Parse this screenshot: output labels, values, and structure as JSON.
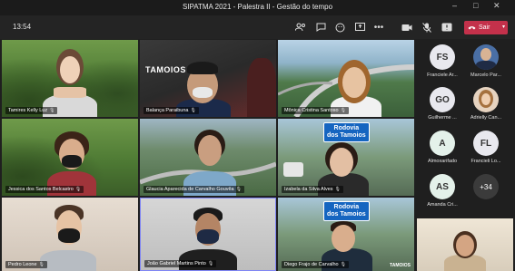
{
  "window": {
    "title": "SIPATMA 2021 - Palestra II - Gestão do tempo"
  },
  "toolbar": {
    "timer": "13:54",
    "leave_label": "Sair"
  },
  "participants": [
    {
      "name": "Tamires Kelly Luz"
    },
    {
      "name": "Balança Paraibuna"
    },
    {
      "name": "Mônica Cristina Santoso"
    },
    {
      "name": "Jessica dos Santos Belcastro"
    },
    {
      "name": "Glaucia Aparecida de Carvalho Gouvêa"
    },
    {
      "name": "Izabela da Silva Alves"
    },
    {
      "name": "Pedro Leone"
    },
    {
      "name": "João Gabriel Martins Pinto"
    },
    {
      "name": "Diego Frajo de Carvalho"
    }
  ],
  "tile_texts": {
    "logo_text": "TAMOIOS",
    "road_sign_line1": "Rodovia",
    "road_sign_line2": "dos Tamoios"
  },
  "side_participants": [
    {
      "initials": "FS",
      "label": "Franciele Ar...",
      "color": "#e8e8ee"
    },
    {
      "initials": "",
      "label": "Marcelo Par...",
      "color": "#4a6fa5"
    },
    {
      "initials": "GO",
      "label": "Guilherme ...",
      "color": "#e8e8ee"
    },
    {
      "initials": "",
      "label": "Adrielly Can...",
      "color": "#c9a27e"
    },
    {
      "initials": "A",
      "label": "Almoxarifado",
      "color": "#e4f1ea"
    },
    {
      "initials": "FL",
      "label": "Francieli Lo...",
      "color": "#e8e8ee"
    },
    {
      "initials": "AS",
      "label": "Amanda Cri...",
      "color": "#e4f1ea"
    }
  ],
  "overflow_count": "+34"
}
